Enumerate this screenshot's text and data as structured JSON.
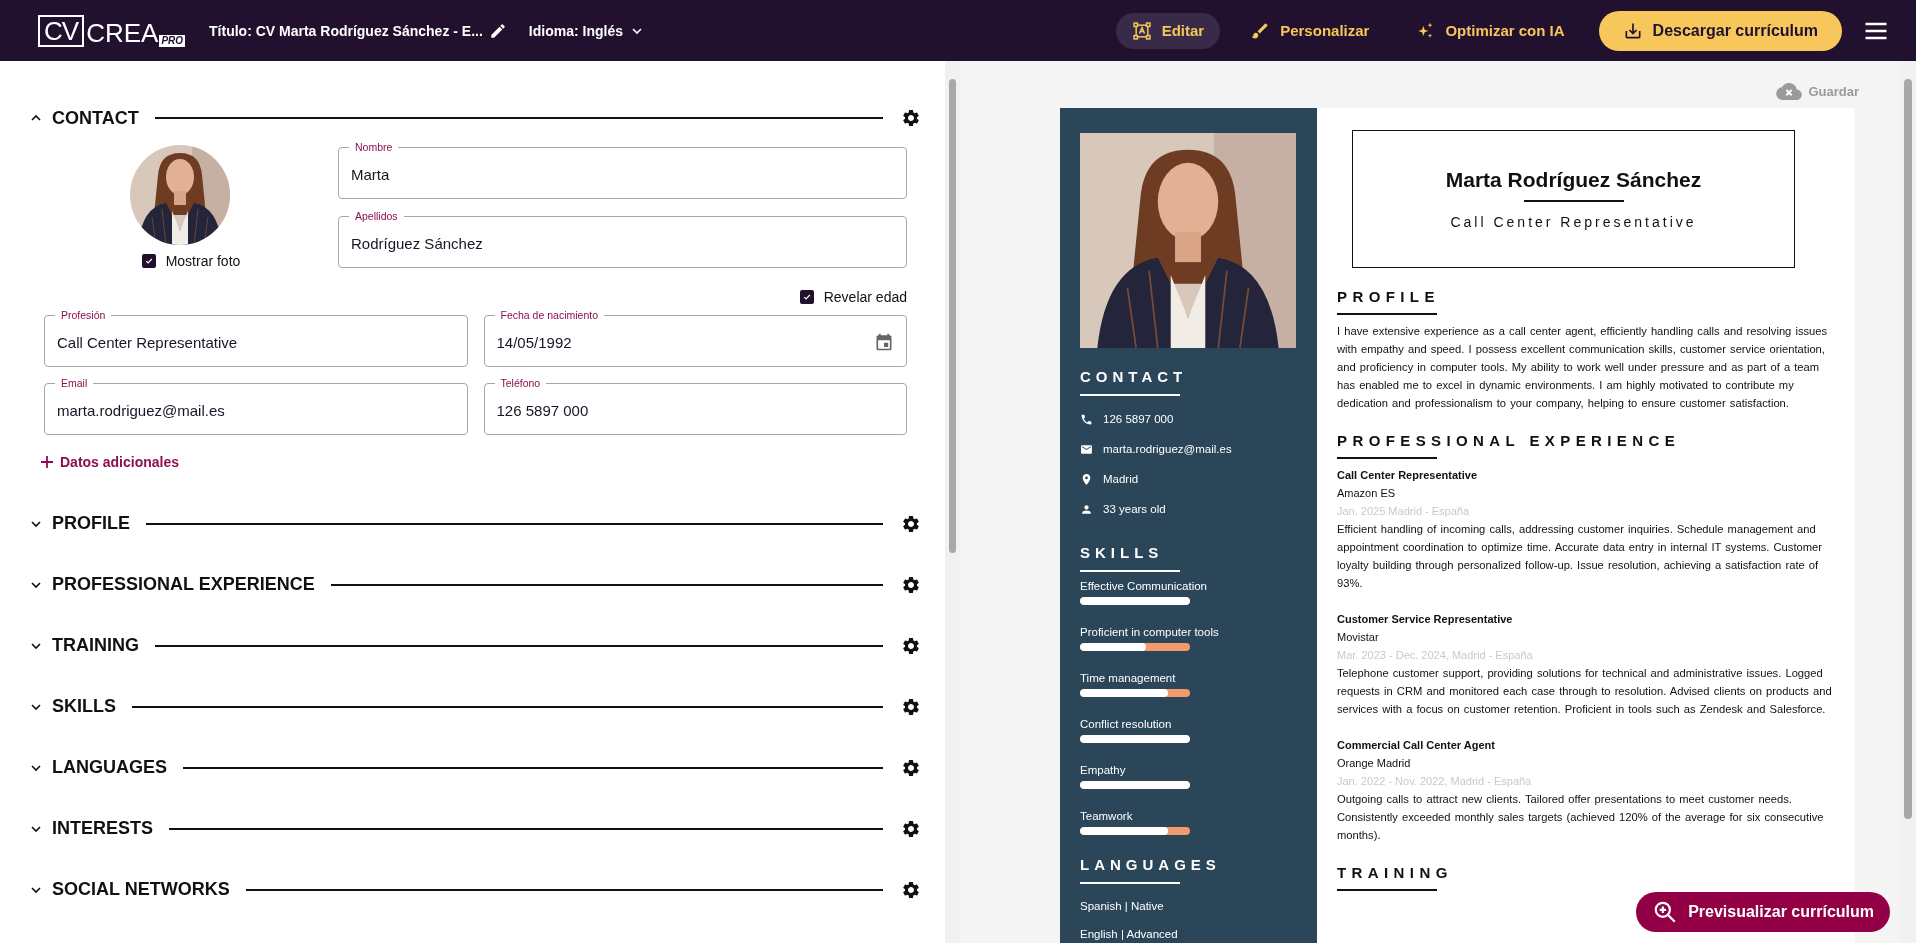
{
  "header": {
    "logo": {
      "mark": "CV",
      "name": "CREA",
      "badge": "PRO"
    },
    "title": "Título: CV Marta Rodríguez Sánchez - E...",
    "language": "Idioma: Inglés",
    "nav": [
      {
        "label": "Editar",
        "kind": "edit",
        "selected": true
      },
      {
        "label": "Personalizar",
        "kind": "customize",
        "selected": false
      },
      {
        "label": "Optimizar con IA",
        "kind": "ai",
        "selected": false
      }
    ],
    "download": "Descargar currículum"
  },
  "editor": {
    "sections": [
      {
        "title": "CONTACT",
        "expanded": true,
        "form": {
          "photo_toggle": {
            "label": "Mostrar foto",
            "checked": true
          },
          "name_fields": [
            {
              "label": "Nombre",
              "value": "Marta",
              "kind": "text"
            },
            {
              "label": "Apellidos",
              "value": "Rodríguez Sánchez",
              "kind": "text"
            }
          ],
          "reveal_age": {
            "label": "Revelar edad",
            "checked": true
          },
          "detail_fields": [
            {
              "label": "Profesión",
              "value": "Call Center Representative",
              "kind": "text"
            },
            {
              "label": "Fecha de nacimiento",
              "value": "14/05/1992",
              "kind": "date"
            },
            {
              "label": "Email",
              "value": "marta.rodriguez@mail.es",
              "kind": "text"
            },
            {
              "label": "Teléfono",
              "value": "126 5897 000",
              "kind": "text"
            }
          ],
          "add_link": "Datos adicionales"
        }
      },
      {
        "title": "PROFILE",
        "expanded": false
      },
      {
        "title": "PROFESSIONAL EXPERIENCE",
        "expanded": false
      },
      {
        "title": "TRAINING",
        "expanded": false
      },
      {
        "title": "SKILLS",
        "expanded": false
      },
      {
        "title": "LANGUAGES",
        "expanded": false
      },
      {
        "title": "INTERESTS",
        "expanded": false
      },
      {
        "title": "SOCIAL NETWORKS",
        "expanded": false
      }
    ]
  },
  "preview": {
    "save_status": "Guardar",
    "preview_button": "Previsualizar currículum",
    "resume": {
      "sidebar": {
        "contact_title": "CONTACT",
        "contact": [
          {
            "kind": "phone",
            "text": "126 5897 000"
          },
          {
            "kind": "email",
            "text": "marta.rodriguez@mail.es"
          },
          {
            "kind": "location",
            "text": "Madrid"
          },
          {
            "kind": "age",
            "text": "33 years old"
          }
        ],
        "skills_title": "SKILLS",
        "skills": [
          {
            "name": "Effective Communication",
            "level": 1
          },
          {
            "name": "Proficient in computer tools",
            "level": 0.6
          },
          {
            "name": "Time management",
            "level": 0.8
          },
          {
            "name": "Conflict resolution",
            "level": 1
          },
          {
            "name": "Empathy",
            "level": 1
          },
          {
            "name": "Teamwork",
            "level": 0.8
          }
        ],
        "languages_title": "LANGUAGES",
        "languages": [
          "Spanish | Native",
          "English | Advanced"
        ]
      },
      "name": "Marta Rodríguez Sánchez",
      "role": "Call Center Representative",
      "profile_title": "PROFILE",
      "profile_text": "I have extensive experience as a call center agent, efficiently handling calls and resolving issues with empathy and speed. I possess excellent communication skills, customer service orientation, and proficiency in computer tools. My ability to work well under pressure and as part of a team has enabled me to excel in dynamic environments. I am highly motivated to contribute my dedication and professionalism to your company, helping to ensure customer satisfaction.",
      "experience_title": "PROFESSIONAL EXPERIENCE",
      "experience": [
        {
          "title": "Call Center Representative",
          "company": "Amazon ES",
          "date": "Jan. 2025 Madrid - España",
          "description": "Efficient handling of incoming calls, addressing customer inquiries. Schedule management and appointment coordination to optimize time. Accurate data entry in internal IT systems. Customer loyalty building through personalized follow-up. Issue resolution, achieving a satisfaction rate of 93%."
        },
        {
          "title": "Customer Service Representative",
          "company": "Movistar",
          "date": "Mar. 2023 - Dec. 2024, Madrid - España",
          "description": "Telephone customer support, providing solutions for technical and administrative issues. Logged requests in CRM and monitored each case through to resolution. Advised clients on products and services with a focus on customer retention. Proficient in tools such as Zendesk and Salesforce."
        },
        {
          "title": "Commercial Call Center Agent",
          "company": "Orange Madrid",
          "date": "Jan. 2022 - Nov. 2022, Madrid - España",
          "description": "Outgoing calls to attract new clients. Tailored offer presentations to meet customer needs. Consistently exceeded monthly sales targets (achieved 120% of the average for six consecutive months)."
        }
      ],
      "training_title": "TRAINING"
    }
  }
}
